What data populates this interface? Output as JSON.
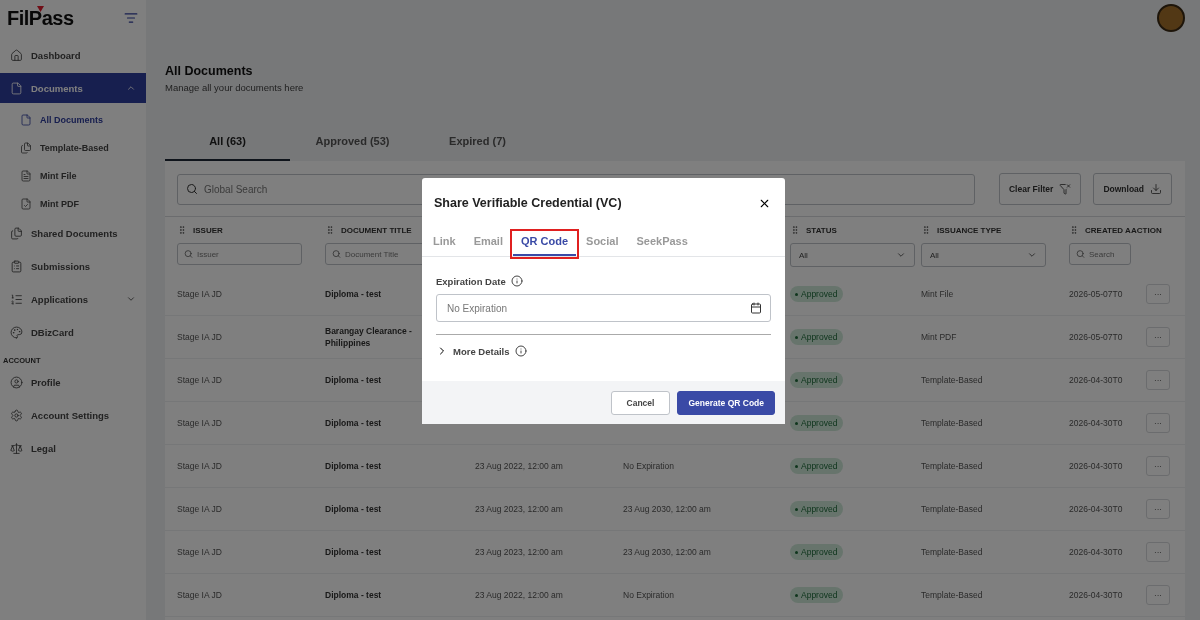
{
  "logo": {
    "text": "FilPass"
  },
  "sidebar": {
    "items": [
      {
        "label": "Dashboard",
        "selected": false
      },
      {
        "label": "Documents",
        "selected": true,
        "expanded": true,
        "children": [
          {
            "label": "All Documents",
            "selected": true
          },
          {
            "label": "Template-Based",
            "selected": false
          },
          {
            "label": "Mint File",
            "selected": false
          },
          {
            "label": "Mint PDF",
            "selected": false
          }
        ]
      },
      {
        "label": "Shared Documents",
        "selected": false
      },
      {
        "label": "Submissions",
        "selected": false
      },
      {
        "label": "Applications",
        "selected": false,
        "expanded": false
      },
      {
        "label": "DBizCard",
        "selected": false
      }
    ],
    "section": "ACCOUNT",
    "account_items": [
      {
        "label": "Profile",
        "selected": false
      },
      {
        "label": "Account Settings",
        "selected": false
      },
      {
        "label": "Legal",
        "selected": false
      }
    ]
  },
  "header": {
    "title": "All Documents",
    "subtitle": "Manage all your documents here"
  },
  "tabs": [
    {
      "label": "All (63)",
      "selected": true
    },
    {
      "label": "Approved (53)",
      "selected": false
    },
    {
      "label": "Expired (7)",
      "selected": false
    }
  ],
  "toolbar": {
    "search_placeholder": "Global Search",
    "buttons": [
      {
        "label": "Clear Filter"
      },
      {
        "label": "Download"
      }
    ]
  },
  "table": {
    "columns": [
      {
        "label": "ISSUER",
        "draggable": true,
        "filter": {
          "kind": "search",
          "placeholder": "Issuer"
        }
      },
      {
        "label": "DOCUMENT TITLE",
        "draggable": true,
        "filter": {
          "kind": "search",
          "placeholder": "Document Title"
        }
      },
      {},
      {},
      {
        "label": "STATUS",
        "draggable": true,
        "filter": {
          "kind": "select",
          "value": "All"
        }
      },
      {
        "label": "ISSUANCE TYPE",
        "draggable": true,
        "filter": {
          "kind": "select",
          "value": "All"
        }
      },
      {
        "label": "CREATED A",
        "draggable": true,
        "filter": {
          "kind": "search",
          "placeholder": "Search"
        }
      },
      {
        "label": "ACTION",
        "draggable": false
      }
    ],
    "rows": [
      {
        "issuer": "Stage IA JD",
        "title": "Diploma - test",
        "status": "Approved",
        "type": "Mint File",
        "created": "2026-05-07T0",
        "action": "···"
      },
      {
        "issuer": "Stage IA JD",
        "title": "Barangay Clearance - Philippines",
        "status": "Approved",
        "type": "Mint PDF",
        "created": "2026-05-07T0",
        "action": "···"
      },
      {
        "issuer": "Stage IA JD",
        "title": "Diploma - test",
        "status": "Approved",
        "type": "Template-Based",
        "created": "2026-04-30T0",
        "action": "···"
      },
      {
        "issuer": "Stage IA JD",
        "title": "Diploma - test",
        "status": "Approved",
        "type": "Template-Based",
        "created": "2026-04-30T0",
        "action": "···"
      },
      {
        "issuer": "Stage IA JD",
        "title": "Diploma - test",
        "issued": "23 Aug 2022, 12:00 am",
        "expires": "No Expiration",
        "status": "Approved",
        "type": "Template-Based",
        "created": "2026-04-30T0",
        "action": "···"
      },
      {
        "issuer": "Stage IA JD",
        "title": "Diploma - test",
        "issued": "23 Aug 2023, 12:00 am",
        "expires": "23 Aug 2030, 12:00 am",
        "status": "Approved",
        "type": "Template-Based",
        "created": "2026-04-30T0",
        "action": "···"
      },
      {
        "issuer": "Stage IA JD",
        "title": "Diploma - test",
        "issued": "23 Aug 2023, 12:00 am",
        "expires": "23 Aug 2030, 12:00 am",
        "status": "Approved",
        "type": "Template-Based",
        "created": "2026-04-30T0",
        "action": "···"
      },
      {
        "issuer": "Stage IA JD",
        "title": "Diploma - test",
        "issued": "23 Aug 2022, 12:00 am",
        "expires": "No Expiration",
        "status": "Approved",
        "type": "Template-Based",
        "created": "2026-04-30T0",
        "action": "···"
      }
    ]
  },
  "modal": {
    "title": "Share Verifiable Credential (VC)",
    "tabs": [
      {
        "label": "Link",
        "selected": false,
        "highlighted": false
      },
      {
        "label": "Email",
        "selected": false,
        "highlighted": false
      },
      {
        "label": "QR Code",
        "selected": true,
        "highlighted": true
      },
      {
        "label": "Social",
        "selected": false,
        "highlighted": false
      },
      {
        "label": "SeekPass",
        "selected": false,
        "highlighted": false
      }
    ],
    "expiration_label": "Expiration Date",
    "expiration_placeholder": "No Expiration",
    "more_details": {
      "label": "More Details",
      "expanded": false
    },
    "buttons": [
      {
        "label": "Cancel",
        "kind": "secondary"
      },
      {
        "label": "Generate QR Code",
        "kind": "primary"
      }
    ]
  }
}
